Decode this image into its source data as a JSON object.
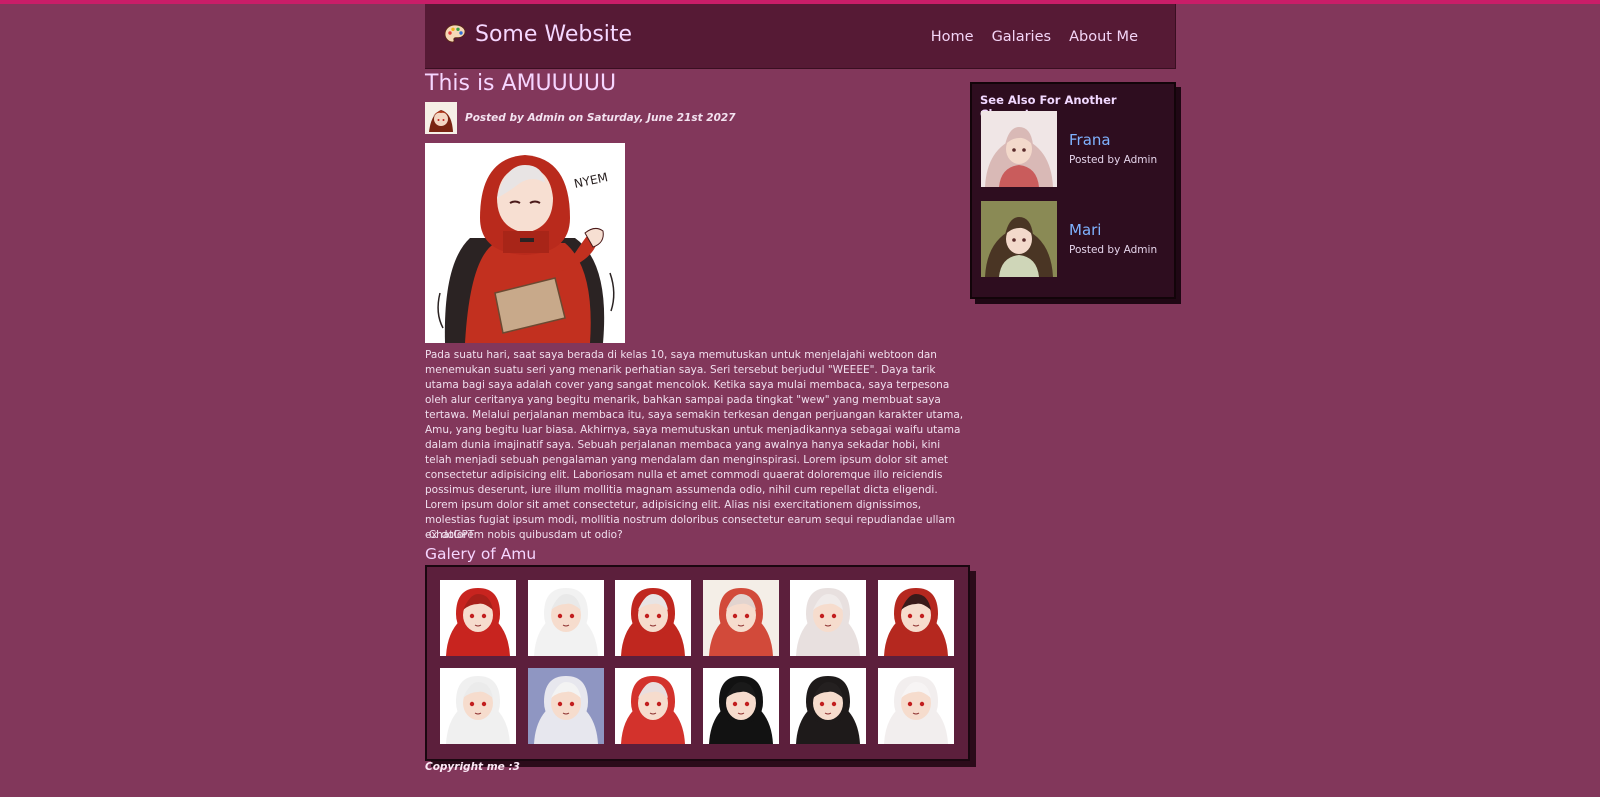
{
  "header": {
    "brand": "Some Website",
    "nav": [
      "Home",
      "Galaries",
      "About Me"
    ]
  },
  "post": {
    "title": "This is AMUUUUU",
    "byline_prefix": "Posted by ",
    "author": "Admin",
    "byline_middle": " on ",
    "date": "Saturday, June 21st 2027",
    "body": "Pada suatu hari, saat saya berada di kelas 10, saya memutuskan untuk menjelajahi webtoon dan menemukan suatu seri yang menarik perhatian saya. Seri tersebut berjudul \"WEEEE\". Daya tarik utama bagi saya adalah cover yang sangat mencolok. Ketika saya mulai membaca, saya terpesona oleh alur ceritanya yang begitu menarik, bahkan sampai pada tingkat \"wew\" yang membuat saya tertawa. Melalui perjalanan membaca itu, saya semakin terkesan dengan perjuangan karakter utama, Amu, yang begitu luar biasa. Akhirnya, saya memutuskan untuk menjadikannya sebagai waifu utama dalam dunia imajinatif saya. Sebuah perjalanan membaca yang awalnya hanya sekadar hobi, kini telah menjadi sebuah pengalaman yang mendalam dan menginspirasi. Lorem ipsum dolor sit amet consectetur adipisicing elit. Laboriosam nulla et amet commodi quaerat doloremque illo reiciendis possimus deserunt, iure illum mollitia magnam assumenda odio, nihil cum repellat dicta eligendi. Lorem ipsum dolor sit amet consectetur, adipisicing elit. Alias nisi exercitationem dignissimos, molestias fugiat ipsum modi, mollitia nostrum doloribus consectetur earum sequi repudiandae ullam ex dolorem nobis quibusdam ut odio?",
    "signature": "-ChatGPT",
    "hero_text": "NYEM"
  },
  "gallery": {
    "title": "Galery of Amu",
    "items": [
      {
        "hood": "#c8241f",
        "hair": "#a8201a",
        "bg": "#ffffff"
      },
      {
        "hood": "#f2f2f2",
        "hair": "#e9e9e9",
        "bg": "#ffffff"
      },
      {
        "hood": "#c0271f",
        "hair": "#e8e4e4",
        "bg": "#ffffff"
      },
      {
        "hood": "#d24a3a",
        "hair": "#e2d4cf",
        "bg": "#f4eee7"
      },
      {
        "hood": "#e8e0df",
        "hair": "#f0ebea",
        "bg": "#ffffff"
      },
      {
        "hood": "#b5281f",
        "hair": "#3a1a1a",
        "bg": "#ffffff"
      },
      {
        "hood": "#f0f0f0",
        "hair": "#ebebeb",
        "bg": "#ffffff"
      },
      {
        "hood": "#e7e7ee",
        "hair": "#f3f3f3",
        "bg": "#8f96c2"
      },
      {
        "hood": "#d3322c",
        "hair": "#e9dede",
        "bg": "#ffffff"
      },
      {
        "hood": "#121212",
        "hair": "#1a1a1a",
        "bg": "#ffffff"
      },
      {
        "hood": "#1e1a1a",
        "hair": "#242020",
        "bg": "#ffffff"
      },
      {
        "hood": "#f2eeee",
        "hair": "#f7f4f4",
        "bg": "#ffffff"
      }
    ]
  },
  "sidebar": {
    "title": "See Also For Another Characters",
    "items": [
      {
        "name": "Frana",
        "by": "Posted by Admin",
        "bg": "#f0e6e6",
        "hair": "#d9b9b6",
        "cloth": "#c95c5c"
      },
      {
        "name": "Mari",
        "by": "Posted by Admin",
        "bg": "#8a8a55",
        "hair": "#4a3524",
        "cloth": "#cfd6b8"
      }
    ]
  },
  "footer": "Copyright me :3",
  "colors": {
    "page_bg": "#82375b",
    "top_strip": "#c91d68",
    "header_bg": "#561a35",
    "sidebar_bg": "#2e0d1f",
    "link": "#7fb2ff"
  },
  "icons": {
    "brand": "palette-icon"
  }
}
